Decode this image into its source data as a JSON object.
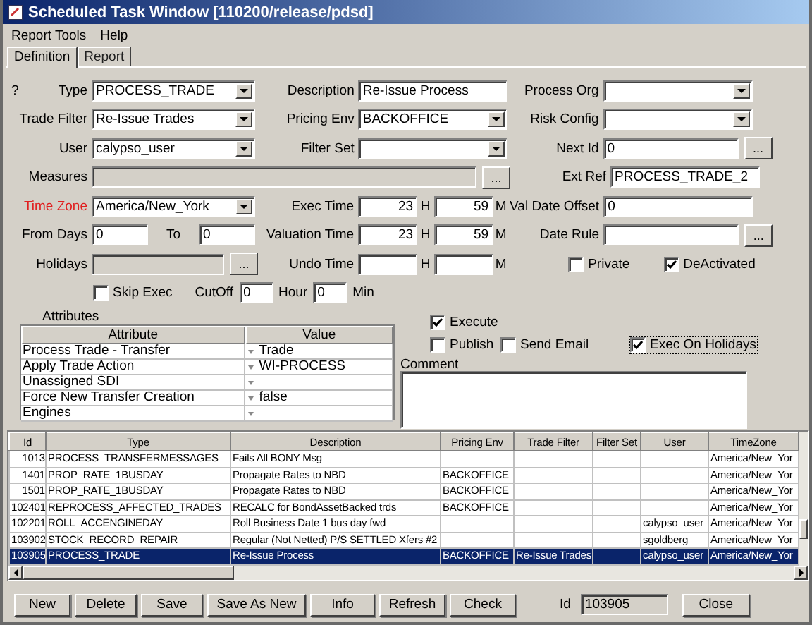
{
  "window": {
    "title": "Scheduled Task Window [110200/release/pdsd]"
  },
  "menu": [
    "Report Tools",
    "Help"
  ],
  "tabs": [
    {
      "label": "Definition",
      "selected": true
    },
    {
      "label": "Report",
      "selected": false
    }
  ],
  "form_rows": [
    {
      "cells": [
        {
          "kind": "combo",
          "prefix": "?",
          "label": "Type",
          "highlight": false,
          "value": "PROCESS_TRADE"
        },
        {
          "kind": "text",
          "label": "Description",
          "highlight": false,
          "value": "Re-Issue Process"
        },
        {
          "kind": "combo",
          "label": "Process Org",
          "highlight": false
        }
      ]
    },
    {
      "cells": [
        {
          "kind": "combo",
          "label": "Trade Filter",
          "highlight": false,
          "value": "Re-Issue Trades"
        },
        {
          "kind": "combo",
          "label": "Pricing Env",
          "highlight": false,
          "value": "BACKOFFICE"
        },
        {
          "kind": "combo",
          "label": "Risk Config",
          "highlight": false
        }
      ]
    },
    {
      "cells": [
        {
          "kind": "combo",
          "label": "User",
          "highlight": false,
          "value": "calypso_user"
        },
        {
          "kind": "combo",
          "label": "Filter Set",
          "highlight": false
        },
        {
          "kind": "more",
          "label": "Next Id",
          "highlight": false,
          "disabled": false,
          "value": "0",
          "button": "..."
        }
      ]
    },
    {
      "cells": [
        {
          "kind": "wide",
          "label": "Measures",
          "highlight": false,
          "disabled": true,
          "button": "..."
        },
        {
          "kind": "text",
          "label": "Ext Ref",
          "highlight": false,
          "value": "PROCESS_TRADE_2"
        }
      ]
    },
    {
      "cells": [
        {
          "kind": "combo",
          "label": "Time Zone",
          "highlight": true,
          "value": "America/New_York"
        },
        {
          "kind": "time",
          "label": "Exec Time",
          "highlight": false,
          "hours": "23",
          "h_unit": "H",
          "minutes": "59",
          "m_unit": "M"
        },
        {
          "kind": "text",
          "label": "Val Date Offset",
          "highlight": false,
          "value": "0"
        }
      ]
    },
    {
      "cells": [
        {
          "kind": "range",
          "label": "From Days",
          "highlight": false,
          "from": "0",
          "to_label": "To",
          "to": "0"
        },
        {
          "kind": "time",
          "label": "Valuation Time",
          "highlight": false,
          "hours": "23",
          "h_unit": "H",
          "minutes": "59",
          "m_unit": "M"
        },
        {
          "kind": "more",
          "label": "Date Rule",
          "highlight": false,
          "disabled": false,
          "button": "..."
        }
      ]
    },
    {
      "cells": [
        {
          "kind": "more",
          "label": "Holidays",
          "highlight": false,
          "disabled": true,
          "button": "..."
        },
        {
          "kind": "time",
          "label": "Undo Time",
          "highlight": false,
          "h_unit": "H",
          "m_unit": "M"
        },
        {
          "kind": "checks",
          "items": [
            {
              "label": "Private",
              "checked": false
            },
            {
              "label": "DeActivated",
              "checked": true
            }
          ]
        }
      ]
    }
  ],
  "cutoff_row": {
    "skip_exec": {
      "label": "Skip Exec",
      "checked": false
    },
    "cutoff_label": "CutOff",
    "hour": "0",
    "hour_label": "Hour",
    "minute": "0",
    "minute_label": "Min"
  },
  "attributes": {
    "title": "Attributes",
    "columns": [
      "Attribute",
      "Value"
    ],
    "rows": [
      {
        "attribute": "Process Trade - Transfer",
        "value": "Trade"
      },
      {
        "attribute": "Apply Trade Action",
        "value": "WI-PROCESS"
      },
      {
        "attribute": "Unassigned SDI"
      },
      {
        "attribute": "Force New Transfer Creation",
        "value": "false"
      },
      {
        "attribute": "Engines"
      }
    ]
  },
  "options": {
    "execute": {
      "label": "Execute",
      "checked": true
    },
    "row": [
      {
        "label": "Publish",
        "checked": false
      },
      {
        "label": "Send Email",
        "checked": false
      },
      {
        "label": "Exec On Holidays",
        "checked": true
      }
    ],
    "comment_label": "Comment"
  },
  "table": {
    "columns": [
      "Id",
      "Type",
      "Description",
      "Pricing Env",
      "Trade Filter",
      "Filter Set",
      "User",
      "TimeZone"
    ],
    "rows": [
      {
        "selected": false,
        "cells": [
          "1013",
          "PROCESS_TRANSFERMESSAGES",
          "Fails All BONY Msg",
          "",
          "",
          "",
          "",
          "America/New_Yor"
        ]
      },
      {
        "selected": false,
        "cells": [
          "1401",
          "PROP_RATE_1BUSDAY",
          "Propagate Rates to NBD",
          "BACKOFFICE",
          "",
          "",
          "",
          "America/New_Yor"
        ]
      },
      {
        "selected": false,
        "cells": [
          "1501",
          "PROP_RATE_1BUSDAY",
          "Propagate Rates to NBD",
          "BACKOFFICE",
          "",
          "",
          "",
          "America/New_Yor"
        ]
      },
      {
        "selected": false,
        "cells": [
          "102401",
          "REPROCESS_AFFECTED_TRADES",
          "RECALC for BondAssetBacked trds",
          "BACKOFFICE",
          "",
          "",
          "",
          "America/New_Yor"
        ]
      },
      {
        "selected": false,
        "cells": [
          "102201",
          "ROLL_ACCENGINEDAY",
          "Roll Business Date 1 bus day fwd",
          "",
          "",
          "",
          "calypso_user",
          "America/New_Yor"
        ]
      },
      {
        "selected": false,
        "cells": [
          "103902",
          "STOCK_RECORD_REPAIR",
          "Regular (Not Netted) P/S SETTLED Xfers #2",
          "",
          "",
          "",
          "sgoldberg",
          "America/New_Yor"
        ]
      },
      {
        "selected": true,
        "cells": [
          "103905",
          "PROCESS_TRADE",
          "Re-Issue Process",
          "BACKOFFICE",
          "Re-Issue Trades",
          "",
          "calypso_user",
          "America/New_Yor"
        ]
      }
    ]
  },
  "buttons": [
    "New",
    "Delete",
    "Save",
    "Save As New",
    "Info",
    "Refresh",
    "Check"
  ],
  "id_field": {
    "label": "Id",
    "value": "103905"
  },
  "close_button": "Close"
}
